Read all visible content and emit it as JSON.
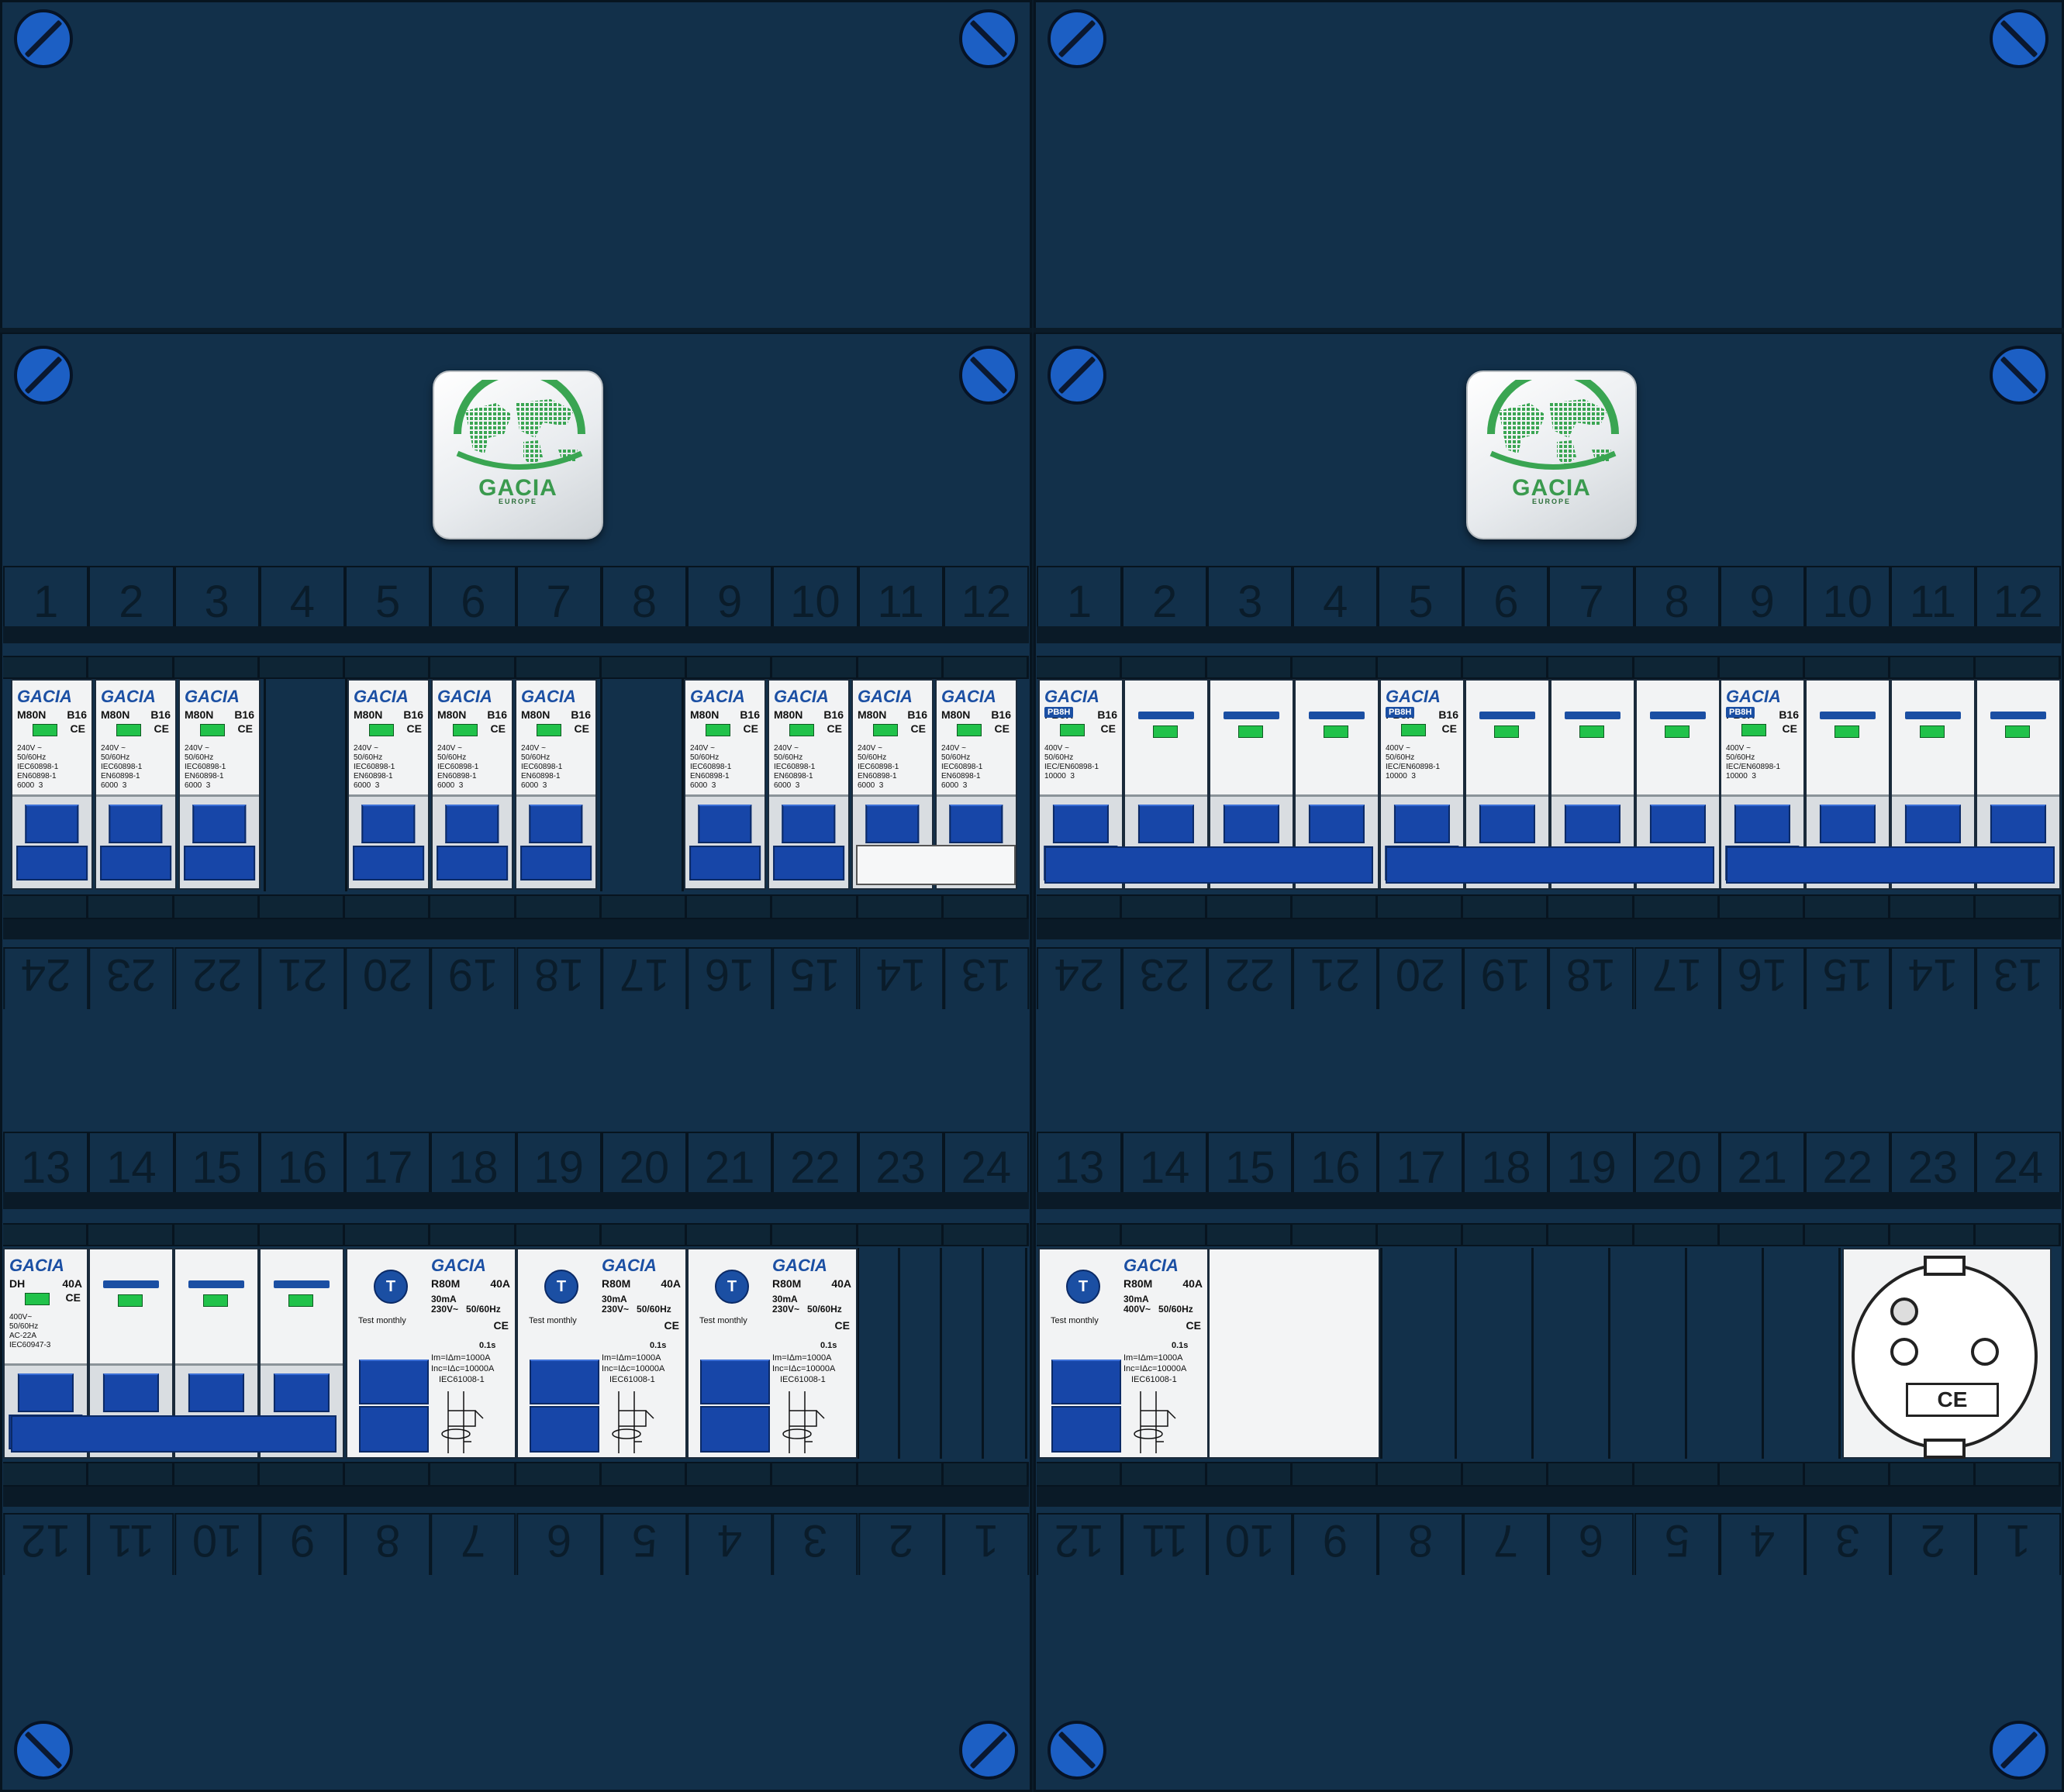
{
  "panels": {
    "top_row_numbers": [
      "1",
      "2",
      "3",
      "4",
      "5",
      "6",
      "7",
      "8",
      "9",
      "10",
      "11",
      "12"
    ],
    "bottom_row_numbers": [
      "13",
      "14",
      "15",
      "16",
      "17",
      "18",
      "19",
      "20",
      "21",
      "22",
      "23",
      "24"
    ],
    "top_row_flipped_numbers": [
      "24",
      "23",
      "22",
      "21",
      "20",
      "19",
      "18",
      "17",
      "16",
      "15",
      "14",
      "13"
    ],
    "bottom_row_flipped_numbers": [
      "12",
      "11",
      "10",
      "9",
      "8",
      "7",
      "6",
      "5",
      "4",
      "3",
      "2",
      "1"
    ]
  },
  "logo": {
    "name": "GACIA",
    "subtitle": "EUROPE"
  },
  "mcb": {
    "brand": "GACIA",
    "model": "M80N",
    "rating": "B16",
    "ce": "CE",
    "spec": "240V ~\n50/60Hz\nIEC60898-1\nEN60898-1\n6000  3"
  },
  "mcb4p": {
    "brand": "GACIA",
    "model": "PB8H",
    "rating": "B16",
    "ce": "CE",
    "spec": "400V ~\n50/60Hz\nIEC/EN60898-1\n10000  3"
  },
  "main_switch": {
    "brand": "GACIA",
    "model": "DH",
    "rating": "40A",
    "ce": "CE",
    "spec": "400V~\n50/60Hz\nAC-22A\nIEC60947-3"
  },
  "rcd": {
    "brand": "GACIA",
    "model": "R80M",
    "rating": "40A",
    "test_label": "Test monthly",
    "button": "T",
    "spec_230": "30mA\n230V~   50/60Hz",
    "spec_400": "30mA\n400V~   50/60Hz",
    "time": "0.1s",
    "im": "Im=IΔm=1000A",
    "inc": "Inc=IΔc=10000A",
    "std": "IEC61008-1",
    "ce": "CE"
  },
  "socket": {
    "mark": "CE"
  },
  "colors": {
    "panel": "#12304a",
    "screw": "#1c5fc4",
    "handle": "#1746a8",
    "brand": "#1b4fa3",
    "indicator": "#21c24a",
    "logo_green": "#3a9a4e"
  },
  "icons": [
    "screw-icon",
    "world-map-icon",
    "test-button-icon",
    "rcd-diagram-icon",
    "schuko-socket-icon"
  ]
}
